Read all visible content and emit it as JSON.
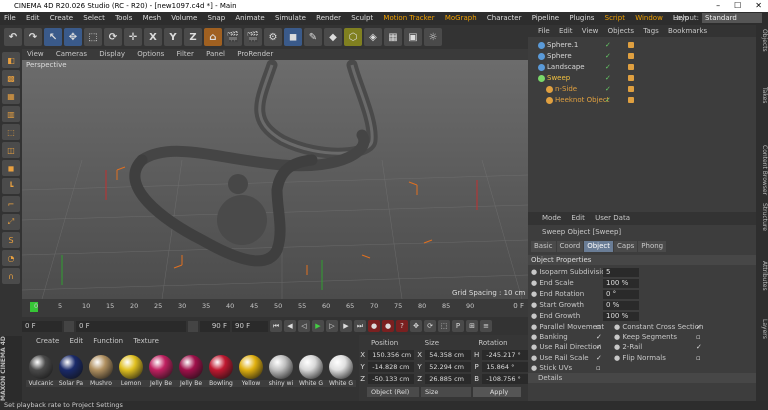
{
  "window": {
    "title": "CINEMA 4D R20.026 Studio (RC - R20) - [new1097.c4d *] - Main",
    "controls": [
      "–",
      "☐",
      "✕"
    ]
  },
  "menubar": {
    "items": [
      "File",
      "Edit",
      "Create",
      "Select",
      "Tools",
      "Mesh",
      "Volume",
      "Snap",
      "Animate",
      "Simulate",
      "Render",
      "Sculpt",
      "Motion Tracker",
      "MoGraph",
      "Character",
      "Pipeline",
      "Plugins",
      "Script",
      "Window",
      "Help"
    ],
    "layout_label": "Layout:",
    "layout_value": "Standard"
  },
  "toolbar": {
    "icons": [
      "undo-icon",
      "redo-icon",
      "select-icon",
      "move-icon",
      "scale-icon",
      "rotate-icon",
      "move2-icon",
      "x-axis",
      "y-axis",
      "z-axis",
      "coord-icon",
      "render-view-icon",
      "render-icon",
      "render-settings-icon",
      "cube-icon",
      "pen-icon",
      "subdivision-icon",
      "array-icon",
      "deformer-icon",
      "environment-icon",
      "camera-icon",
      "light-icon"
    ],
    "axis_labels": [
      "X",
      "Y",
      "Z"
    ]
  },
  "viewport": {
    "menu": [
      "View",
      "Cameras",
      "Display",
      "Options",
      "Filter",
      "Panel",
      "ProRender"
    ],
    "camera_label": "Perspective",
    "grid_spacing": "Grid Spacing : 10 cm"
  },
  "timeline": {
    "ticks": [
      "0",
      "5",
      "10",
      "15",
      "20",
      "25",
      "30",
      "35",
      "40",
      "45",
      "50",
      "55",
      "60",
      "65",
      "70",
      "75",
      "80",
      "85",
      "90"
    ],
    "end_label": "0 F"
  },
  "transport": {
    "current_frame": "0 F",
    "start_frame": "0 F",
    "preview_end": "90 F",
    "end_frame": "90 F"
  },
  "materials": {
    "menu": [
      "Create",
      "Edit",
      "Function",
      "Texture"
    ],
    "items": [
      {
        "label": "Vulcanic",
        "color": "#4a4a4a"
      },
      {
        "label": "Solar Pa",
        "color": "#1a2a6a"
      },
      {
        "label": "Mushro",
        "color": "#b09060"
      },
      {
        "label": "Lemon",
        "color": "#e0c020"
      },
      {
        "label": "Jelly Be",
        "color": "#c02060"
      },
      {
        "label": "Jelly Be",
        "color": "#a0104a"
      },
      {
        "label": "Bowling",
        "color": "#c01830"
      },
      {
        "label": "Yellow",
        "color": "#e0b010"
      },
      {
        "label": "shiny wi",
        "color": "#c0c0c0"
      },
      {
        "label": "White G",
        "color": "#d8d8d8"
      },
      {
        "label": "White G",
        "color": "#e0e0e0"
      }
    ]
  },
  "coordinates": {
    "headers": [
      "Position",
      "Size",
      "Rotation"
    ],
    "rows": [
      {
        "axis": "X",
        "pos": "150.356 cm",
        "size": "54.358 cm",
        "raxis": "H",
        "rot": "-245.217 °"
      },
      {
        "axis": "Y",
        "pos": "-14.828 cm",
        "size": "52.294 cm",
        "raxis": "P",
        "rot": "15.864 °"
      },
      {
        "axis": "Z",
        "pos": "-50.133 cm",
        "size": "26.885 cm",
        "raxis": "B",
        "rot": "-108.756 °"
      }
    ],
    "mode": "Object (Rel)",
    "size_mode": "Size",
    "apply": "Apply"
  },
  "objects": {
    "menu": [
      "File",
      "Edit",
      "View",
      "Objects",
      "Tags",
      "Bookmarks"
    ],
    "rows": [
      {
        "name": "Sphere.1",
        "color": "#5a9ad8",
        "indent": 0,
        "text_color": "#d8d8d8"
      },
      {
        "name": "Sphere",
        "color": "#5a9ad8",
        "indent": 0,
        "text_color": "#d8d8d8"
      },
      {
        "name": "Landscape",
        "color": "#5a9ad8",
        "indent": 0,
        "text_color": "#d8d8d8"
      },
      {
        "name": "Sweep",
        "color": "#7ad86a",
        "indent": 0,
        "text_color": "#f0c040"
      },
      {
        "name": "n-Side",
        "color": "#e0a040",
        "indent": 8,
        "text_color": "#e0a040"
      },
      {
        "name": "Heeknot Object",
        "color": "#e0a040",
        "indent": 8,
        "text_color": "#e0a040"
      }
    ]
  },
  "attributes": {
    "menu": [
      "Mode",
      "Edit",
      "User Data"
    ],
    "title": "Sweep Object [Sweep]",
    "tabs": [
      "Basic",
      "Coord",
      "Object",
      "Caps",
      "Phong"
    ],
    "active_tab": "Object",
    "section": "Object Properties",
    "fields": [
      {
        "label": "Isoparm Subdivision",
        "value": "5"
      },
      {
        "label": "End Scale",
        "value": "100 %"
      },
      {
        "label": "End Rotation",
        "value": "0 °"
      },
      {
        "label": "Start Growth",
        "value": "0 %"
      },
      {
        "label": "End Growth",
        "value": "100 %"
      }
    ],
    "checks_left": [
      {
        "label": "Parallel Movement",
        "checked": false
      },
      {
        "label": "Banking",
        "checked": true
      },
      {
        "label": "Use Rail Direction",
        "checked": true
      },
      {
        "label": "Use Rail Scale",
        "checked": true
      },
      {
        "label": "Stick UVs",
        "checked": false
      }
    ],
    "checks_right": [
      {
        "label": "Constant Cross Section",
        "checked": true
      },
      {
        "label": "Keep Segments",
        "checked": false
      },
      {
        "label": "2-Rail",
        "checked": true
      },
      {
        "label": "Flip Normals",
        "checked": false
      }
    ],
    "details": "Details"
  },
  "side_tabs": [
    "Objects",
    "Takes",
    "Content Browser",
    "Structure",
    "Attributes",
    "Layers"
  ],
  "brand": "MAXON CINEMA 4D",
  "status": "Set playback rate to Project Settings"
}
